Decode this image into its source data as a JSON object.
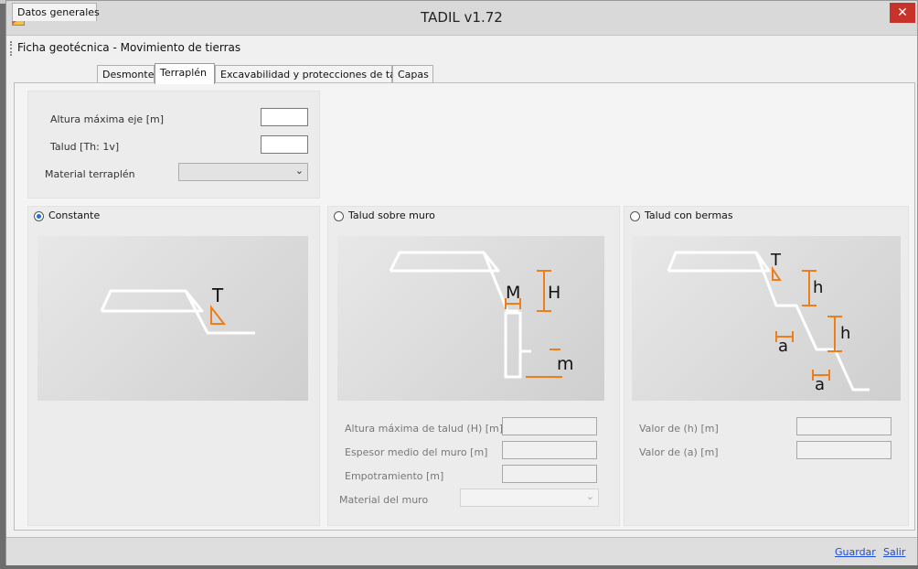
{
  "window": {
    "title": "TADIL v1.72",
    "close_glyph": "✕",
    "icon": "app-icon"
  },
  "menu": {
    "item": "Ficha geotécnica - Movimiento de tierras"
  },
  "tabs": [
    {
      "label": "Datos generales"
    },
    {
      "label": "Desmonte"
    },
    {
      "label": "Terraplén"
    },
    {
      "label": "Excavabilidad y protecciones de talud"
    },
    {
      "label": "Capas"
    }
  ],
  "active_tab": "Terraplén",
  "general": {
    "altura_label": "Altura máxima eje [m]",
    "altura_value": "",
    "talud_label": "Talud [Th: 1v]",
    "talud_value": "",
    "material_label": "Material terraplén",
    "material_value": ""
  },
  "options": [
    {
      "label": "Constante",
      "selected": true
    },
    {
      "label": "Talud sobre muro",
      "selected": false
    },
    {
      "label": "Talud con bermas",
      "selected": false
    }
  ],
  "diagrams": {
    "constante": {
      "T": "T"
    },
    "muro": {
      "M": "M",
      "H": "H",
      "m": "m"
    },
    "bermas": {
      "T": "T",
      "h1": "h",
      "h2": "h",
      "a1": "a",
      "a2": "a"
    }
  },
  "muro_fields": {
    "altura_label": "Altura máxima de talud (H) [m]",
    "altura_value": "",
    "espesor_label": "Espesor medio del muro [m]",
    "espesor_value": "",
    "empotramiento_label": "Empotramiento [m]",
    "empotramiento_value": "",
    "material_label": "Material del muro",
    "material_value": ""
  },
  "bermas_fields": {
    "h_label": "Valor de (h) [m]",
    "h_value": "",
    "a_label": "Valor de (a) [m]",
    "a_value": ""
  },
  "footer": {
    "guardar": "Guardar",
    "salir": "Salir"
  },
  "colors": {
    "accent_orange": "#ef7d1a",
    "link_blue": "#1d4cd8",
    "radio_selected": "#1c6fd8",
    "close_red": "#c7322a"
  }
}
